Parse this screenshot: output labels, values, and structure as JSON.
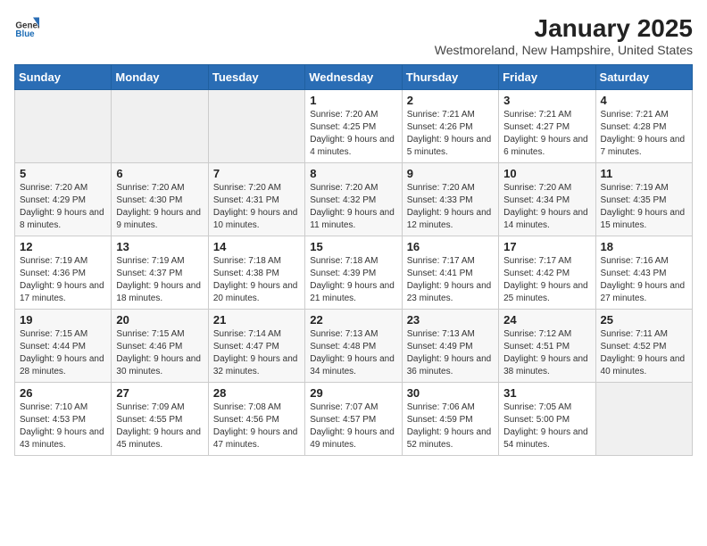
{
  "logo": {
    "text_general": "General",
    "text_blue": "Blue"
  },
  "calendar": {
    "title": "January 2025",
    "subtitle": "Westmoreland, New Hampshire, United States",
    "days_of_week": [
      "Sunday",
      "Monday",
      "Tuesday",
      "Wednesday",
      "Thursday",
      "Friday",
      "Saturday"
    ],
    "weeks": [
      [
        {
          "day": "",
          "info": ""
        },
        {
          "day": "",
          "info": ""
        },
        {
          "day": "",
          "info": ""
        },
        {
          "day": "1",
          "info": "Sunrise: 7:20 AM\nSunset: 4:25 PM\nDaylight: 9 hours and 4 minutes."
        },
        {
          "day": "2",
          "info": "Sunrise: 7:21 AM\nSunset: 4:26 PM\nDaylight: 9 hours and 5 minutes."
        },
        {
          "day": "3",
          "info": "Sunrise: 7:21 AM\nSunset: 4:27 PM\nDaylight: 9 hours and 6 minutes."
        },
        {
          "day": "4",
          "info": "Sunrise: 7:21 AM\nSunset: 4:28 PM\nDaylight: 9 hours and 7 minutes."
        }
      ],
      [
        {
          "day": "5",
          "info": "Sunrise: 7:20 AM\nSunset: 4:29 PM\nDaylight: 9 hours and 8 minutes."
        },
        {
          "day": "6",
          "info": "Sunrise: 7:20 AM\nSunset: 4:30 PM\nDaylight: 9 hours and 9 minutes."
        },
        {
          "day": "7",
          "info": "Sunrise: 7:20 AM\nSunset: 4:31 PM\nDaylight: 9 hours and 10 minutes."
        },
        {
          "day": "8",
          "info": "Sunrise: 7:20 AM\nSunset: 4:32 PM\nDaylight: 9 hours and 11 minutes."
        },
        {
          "day": "9",
          "info": "Sunrise: 7:20 AM\nSunset: 4:33 PM\nDaylight: 9 hours and 12 minutes."
        },
        {
          "day": "10",
          "info": "Sunrise: 7:20 AM\nSunset: 4:34 PM\nDaylight: 9 hours and 14 minutes."
        },
        {
          "day": "11",
          "info": "Sunrise: 7:19 AM\nSunset: 4:35 PM\nDaylight: 9 hours and 15 minutes."
        }
      ],
      [
        {
          "day": "12",
          "info": "Sunrise: 7:19 AM\nSunset: 4:36 PM\nDaylight: 9 hours and 17 minutes."
        },
        {
          "day": "13",
          "info": "Sunrise: 7:19 AM\nSunset: 4:37 PM\nDaylight: 9 hours and 18 minutes."
        },
        {
          "day": "14",
          "info": "Sunrise: 7:18 AM\nSunset: 4:38 PM\nDaylight: 9 hours and 20 minutes."
        },
        {
          "day": "15",
          "info": "Sunrise: 7:18 AM\nSunset: 4:39 PM\nDaylight: 9 hours and 21 minutes."
        },
        {
          "day": "16",
          "info": "Sunrise: 7:17 AM\nSunset: 4:41 PM\nDaylight: 9 hours and 23 minutes."
        },
        {
          "day": "17",
          "info": "Sunrise: 7:17 AM\nSunset: 4:42 PM\nDaylight: 9 hours and 25 minutes."
        },
        {
          "day": "18",
          "info": "Sunrise: 7:16 AM\nSunset: 4:43 PM\nDaylight: 9 hours and 27 minutes."
        }
      ],
      [
        {
          "day": "19",
          "info": "Sunrise: 7:15 AM\nSunset: 4:44 PM\nDaylight: 9 hours and 28 minutes."
        },
        {
          "day": "20",
          "info": "Sunrise: 7:15 AM\nSunset: 4:46 PM\nDaylight: 9 hours and 30 minutes."
        },
        {
          "day": "21",
          "info": "Sunrise: 7:14 AM\nSunset: 4:47 PM\nDaylight: 9 hours and 32 minutes."
        },
        {
          "day": "22",
          "info": "Sunrise: 7:13 AM\nSunset: 4:48 PM\nDaylight: 9 hours and 34 minutes."
        },
        {
          "day": "23",
          "info": "Sunrise: 7:13 AM\nSunset: 4:49 PM\nDaylight: 9 hours and 36 minutes."
        },
        {
          "day": "24",
          "info": "Sunrise: 7:12 AM\nSunset: 4:51 PM\nDaylight: 9 hours and 38 minutes."
        },
        {
          "day": "25",
          "info": "Sunrise: 7:11 AM\nSunset: 4:52 PM\nDaylight: 9 hours and 40 minutes."
        }
      ],
      [
        {
          "day": "26",
          "info": "Sunrise: 7:10 AM\nSunset: 4:53 PM\nDaylight: 9 hours and 43 minutes."
        },
        {
          "day": "27",
          "info": "Sunrise: 7:09 AM\nSunset: 4:55 PM\nDaylight: 9 hours and 45 minutes."
        },
        {
          "day": "28",
          "info": "Sunrise: 7:08 AM\nSunset: 4:56 PM\nDaylight: 9 hours and 47 minutes."
        },
        {
          "day": "29",
          "info": "Sunrise: 7:07 AM\nSunset: 4:57 PM\nDaylight: 9 hours and 49 minutes."
        },
        {
          "day": "30",
          "info": "Sunrise: 7:06 AM\nSunset: 4:59 PM\nDaylight: 9 hours and 52 minutes."
        },
        {
          "day": "31",
          "info": "Sunrise: 7:05 AM\nSunset: 5:00 PM\nDaylight: 9 hours and 54 minutes."
        },
        {
          "day": "",
          "info": ""
        }
      ]
    ]
  }
}
